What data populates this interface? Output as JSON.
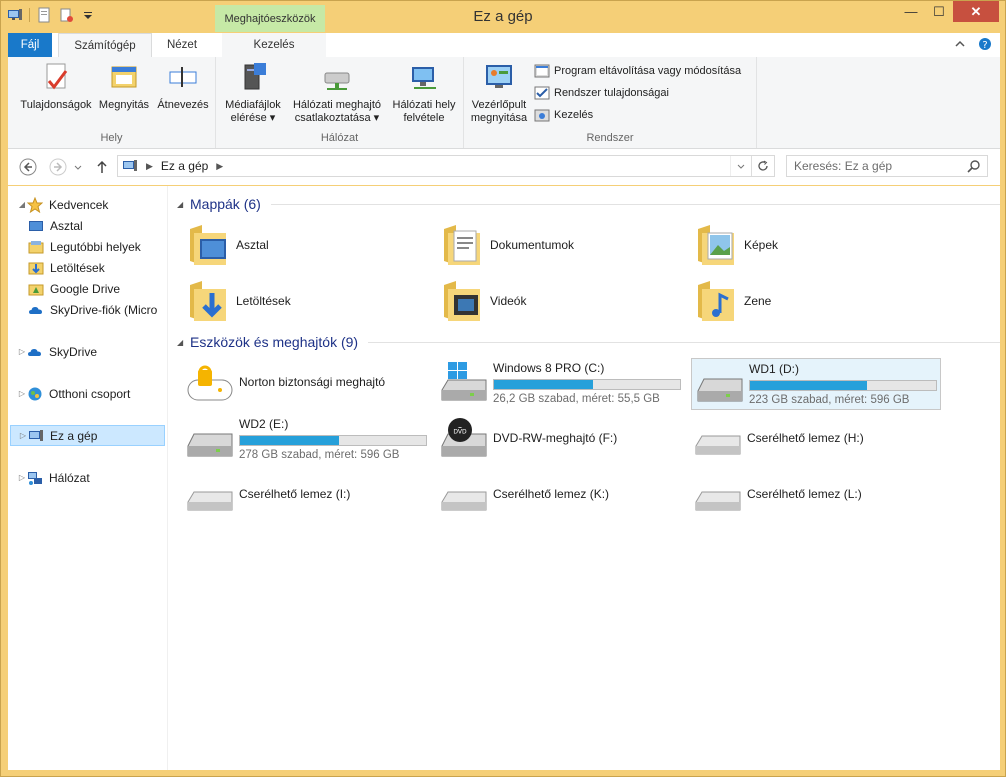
{
  "window": {
    "title": "Ez a gép",
    "context_tab": "Meghajtóeszközök",
    "close_label": "✕",
    "minimize_label": "—",
    "maximize_label": "☐"
  },
  "tabs": {
    "file": "Fájl",
    "computer": "Számítógép",
    "view": "Nézet",
    "manage": "Kezelés"
  },
  "ribbon": {
    "location": {
      "label": "Hely",
      "properties": "Tulajdonságok",
      "open": "Megnyitás",
      "rename": "Átnevezés"
    },
    "network": {
      "label": "Hálózat",
      "media_line1": "Médiafájlok",
      "media_line2": "elérése ▾",
      "map_line1": "Hálózati meghajtó",
      "map_line2": "csatlakoztatása ▾",
      "add_line1": "Hálózati hely",
      "add_line2": "felvétele"
    },
    "system": {
      "label": "Rendszer",
      "cp_line1": "Vezérlőpult",
      "cp_line2": "megnyitása",
      "uninstall": "Program eltávolítása vagy módosítása",
      "sysprops": "Rendszer tulajdonságai",
      "manage": "Kezelés"
    }
  },
  "address": {
    "path": "Ez a gép",
    "search_placeholder": "Keresés: Ez a gép"
  },
  "nav": {
    "favorites": "Kedvencek",
    "desktop": "Asztal",
    "recent": "Legutóbbi helyek",
    "downloads": "Letöltések",
    "gdrive": "Google Drive",
    "skydrive_account": "SkyDrive-fiók (Micro",
    "skydrive": "SkyDrive",
    "homegroup": "Otthoni csoport",
    "thispc": "Ez a gép",
    "network": "Hálózat"
  },
  "sections": {
    "folders": "Mappák (6)",
    "devices": "Eszközök és meghajtók (9)"
  },
  "folders": [
    "Asztal",
    "Dokumentumok",
    "Képek",
    "Letöltések",
    "Videók",
    "Zene"
  ],
  "drives": [
    {
      "name": "Norton biztonsági meghajtó"
    },
    {
      "name": "Windows 8 PRO (C:)",
      "info": "26,2 GB szabad, méret: 55,5 GB",
      "used_fraction": 0.53
    },
    {
      "name": "WD1 (D:)",
      "info": "223 GB szabad, méret: 596 GB",
      "used_fraction": 0.63
    },
    {
      "name": "WD2 (E:)",
      "info": "278 GB szabad, méret: 596 GB",
      "used_fraction": 0.53
    },
    {
      "name": "DVD-RW-meghajtó (F:)"
    },
    {
      "name": "Cserélhető lemez (H:)"
    },
    {
      "name": "Cserélhető lemez (I:)"
    },
    {
      "name": "Cserélhető lemez (K:)"
    },
    {
      "name": "Cserélhető lemez (L:)"
    }
  ],
  "colors": {
    "accent": "#1979ca",
    "progress": "#26a0da",
    "heading": "#1e3287",
    "frame": "#f5cf77"
  }
}
